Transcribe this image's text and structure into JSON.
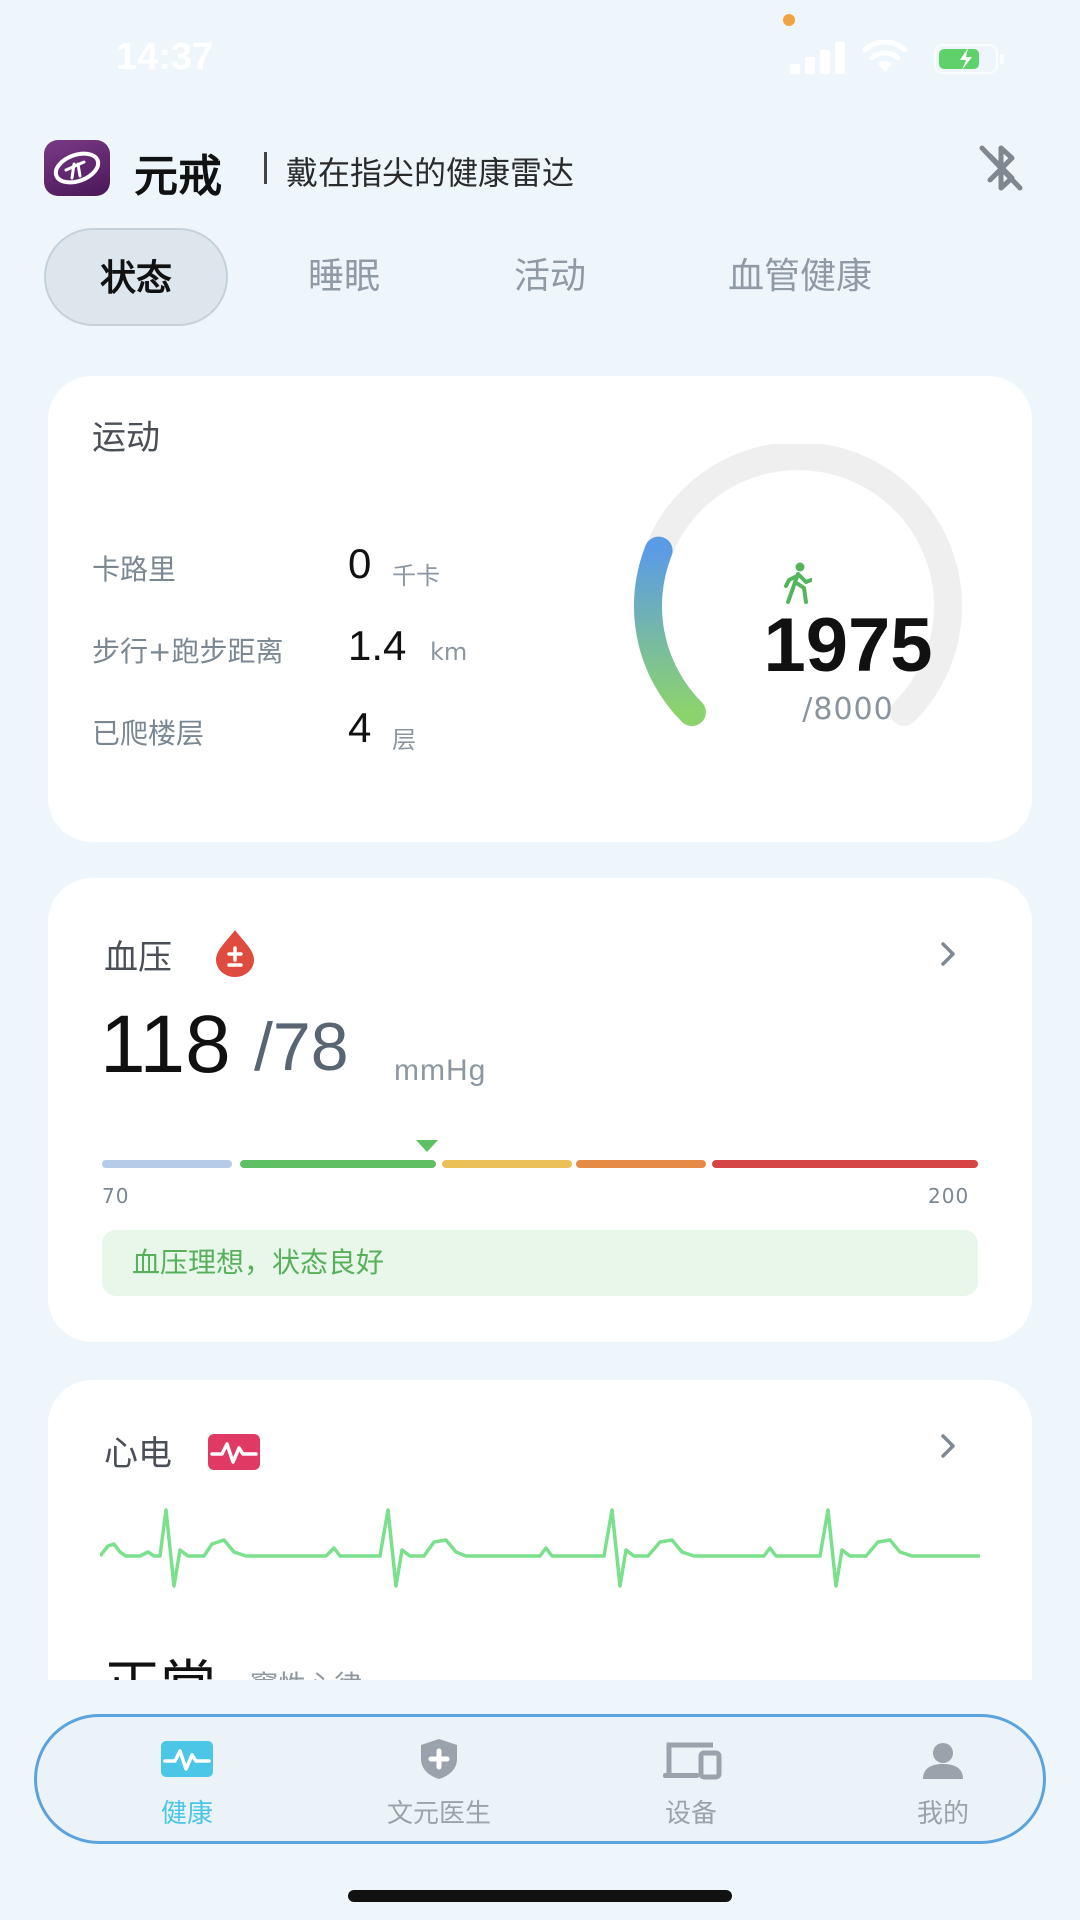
{
  "status_bar": {
    "time": "14:37",
    "icons": [
      "cellular-signal-icon",
      "wifi-icon",
      "battery-charging-icon"
    ]
  },
  "header": {
    "title": "元戒",
    "slogan": "戴在指尖的健康雷达",
    "logo_icon": "ring-logo-icon",
    "bluetooth_icon": "bluetooth-off-icon"
  },
  "tabs": [
    {
      "label": "状态",
      "active": true
    },
    {
      "label": "睡眠",
      "active": false
    },
    {
      "label": "活动",
      "active": false
    },
    {
      "label": "血管健康",
      "active": false
    }
  ],
  "exercise": {
    "title": "运动",
    "metrics": [
      {
        "label": "卡路里",
        "value": "0",
        "unit": "千卡"
      },
      {
        "label": "步行+跑步距离",
        "value": "1.4",
        "unit": "km"
      },
      {
        "label": "已爬楼层",
        "value": "4",
        "unit": "层"
      }
    ],
    "steps": "1975",
    "steps_goal": "/8000",
    "steps_progress": 0.247,
    "icon": "walking-icon",
    "gauge_colors": {
      "start": "#5b9be6",
      "end": "#8dd36d",
      "track": "#efefef"
    }
  },
  "blood_pressure": {
    "title": "血压",
    "systolic": "118",
    "diastolic": "/78",
    "unit": "mmHg",
    "scale_min": "70",
    "scale_max": "200",
    "status_text": "血压理想，状态良好",
    "icon": "blood-drop-icon",
    "segment_colors": [
      "#b4cce8",
      "#5fbf63",
      "#ecc058",
      "#e58b45",
      "#d64545"
    ]
  },
  "ecg": {
    "title": "心电",
    "result": "正常",
    "result_detail": "窦性心律",
    "icon": "ecg-heart-icon",
    "wave_color": "#7be08c"
  },
  "bottom_nav": [
    {
      "label": "健康",
      "icon": "health-pulse-icon",
      "active": true
    },
    {
      "label": "文元医生",
      "icon": "shield-cross-icon",
      "active": false
    },
    {
      "label": "设备",
      "icon": "devices-icon",
      "active": false
    },
    {
      "label": "我的",
      "icon": "person-icon",
      "active": false
    }
  ],
  "colors": {
    "background": "#eef6fc",
    "accent": "#4cc6e6",
    "nav_border": "#5aa3de",
    "good_green": "#57b15b",
    "bp_red": "#e04b3f",
    "ecg_pink": "#e03a64"
  }
}
